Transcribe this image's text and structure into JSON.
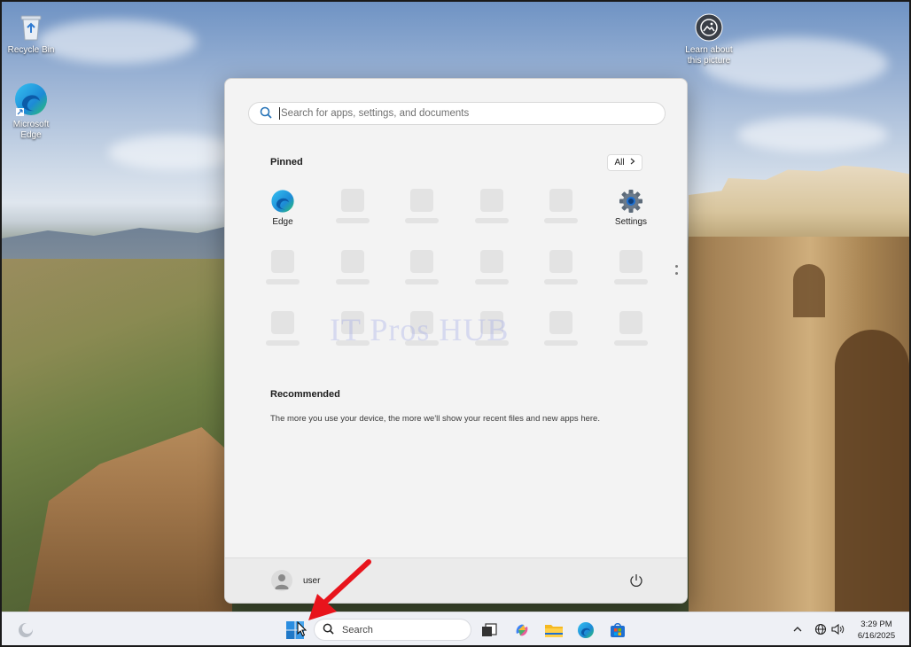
{
  "desktop": {
    "icons": [
      {
        "label": "Recycle Bin"
      },
      {
        "label": "Microsoft Edge"
      },
      {
        "label": "Learn about this picture"
      }
    ]
  },
  "start_menu": {
    "search_placeholder": "Search for apps, settings, and documents",
    "pinned_title": "Pinned",
    "all_button_label": "All",
    "pinned_apps": [
      {
        "label": "Edge",
        "icon": "edge-icon"
      },
      {
        "label": "Settings",
        "icon": "gear-icon"
      }
    ],
    "recommended_title": "Recommended",
    "recommended_text": "The more you use your device, the more we'll show your recent files and new apps here.",
    "watermark": "IT Pros HUB",
    "user_name": "user"
  },
  "taskbar": {
    "search_label": "Search",
    "time": "3:29 PM",
    "date": "6/16/2025"
  }
}
